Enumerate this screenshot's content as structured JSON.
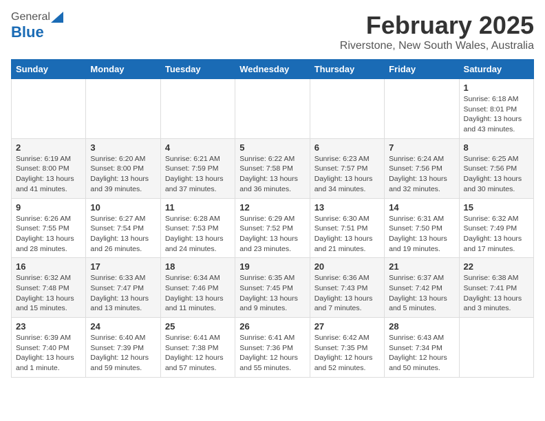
{
  "header": {
    "logo_general": "General",
    "logo_blue": "Blue",
    "month_title": "February 2025",
    "subtitle": "Riverstone, New South Wales, Australia"
  },
  "days_of_week": [
    "Sunday",
    "Monday",
    "Tuesday",
    "Wednesday",
    "Thursday",
    "Friday",
    "Saturday"
  ],
  "weeks": [
    [
      {
        "day": "",
        "info": ""
      },
      {
        "day": "",
        "info": ""
      },
      {
        "day": "",
        "info": ""
      },
      {
        "day": "",
        "info": ""
      },
      {
        "day": "",
        "info": ""
      },
      {
        "day": "",
        "info": ""
      },
      {
        "day": "1",
        "info": "Sunrise: 6:18 AM\nSunset: 8:01 PM\nDaylight: 13 hours\nand 43 minutes."
      }
    ],
    [
      {
        "day": "2",
        "info": "Sunrise: 6:19 AM\nSunset: 8:00 PM\nDaylight: 13 hours\nand 41 minutes."
      },
      {
        "day": "3",
        "info": "Sunrise: 6:20 AM\nSunset: 8:00 PM\nDaylight: 13 hours\nand 39 minutes."
      },
      {
        "day": "4",
        "info": "Sunrise: 6:21 AM\nSunset: 7:59 PM\nDaylight: 13 hours\nand 37 minutes."
      },
      {
        "day": "5",
        "info": "Sunrise: 6:22 AM\nSunset: 7:58 PM\nDaylight: 13 hours\nand 36 minutes."
      },
      {
        "day": "6",
        "info": "Sunrise: 6:23 AM\nSunset: 7:57 PM\nDaylight: 13 hours\nand 34 minutes."
      },
      {
        "day": "7",
        "info": "Sunrise: 6:24 AM\nSunset: 7:56 PM\nDaylight: 13 hours\nand 32 minutes."
      },
      {
        "day": "8",
        "info": "Sunrise: 6:25 AM\nSunset: 7:56 PM\nDaylight: 13 hours\nand 30 minutes."
      }
    ],
    [
      {
        "day": "9",
        "info": "Sunrise: 6:26 AM\nSunset: 7:55 PM\nDaylight: 13 hours\nand 28 minutes."
      },
      {
        "day": "10",
        "info": "Sunrise: 6:27 AM\nSunset: 7:54 PM\nDaylight: 13 hours\nand 26 minutes."
      },
      {
        "day": "11",
        "info": "Sunrise: 6:28 AM\nSunset: 7:53 PM\nDaylight: 13 hours\nand 24 minutes."
      },
      {
        "day": "12",
        "info": "Sunrise: 6:29 AM\nSunset: 7:52 PM\nDaylight: 13 hours\nand 23 minutes."
      },
      {
        "day": "13",
        "info": "Sunrise: 6:30 AM\nSunset: 7:51 PM\nDaylight: 13 hours\nand 21 minutes."
      },
      {
        "day": "14",
        "info": "Sunrise: 6:31 AM\nSunset: 7:50 PM\nDaylight: 13 hours\nand 19 minutes."
      },
      {
        "day": "15",
        "info": "Sunrise: 6:32 AM\nSunset: 7:49 PM\nDaylight: 13 hours\nand 17 minutes."
      }
    ],
    [
      {
        "day": "16",
        "info": "Sunrise: 6:32 AM\nSunset: 7:48 PM\nDaylight: 13 hours\nand 15 minutes."
      },
      {
        "day": "17",
        "info": "Sunrise: 6:33 AM\nSunset: 7:47 PM\nDaylight: 13 hours\nand 13 minutes."
      },
      {
        "day": "18",
        "info": "Sunrise: 6:34 AM\nSunset: 7:46 PM\nDaylight: 13 hours\nand 11 minutes."
      },
      {
        "day": "19",
        "info": "Sunrise: 6:35 AM\nSunset: 7:45 PM\nDaylight: 13 hours\nand 9 minutes."
      },
      {
        "day": "20",
        "info": "Sunrise: 6:36 AM\nSunset: 7:43 PM\nDaylight: 13 hours\nand 7 minutes."
      },
      {
        "day": "21",
        "info": "Sunrise: 6:37 AM\nSunset: 7:42 PM\nDaylight: 13 hours\nand 5 minutes."
      },
      {
        "day": "22",
        "info": "Sunrise: 6:38 AM\nSunset: 7:41 PM\nDaylight: 13 hours\nand 3 minutes."
      }
    ],
    [
      {
        "day": "23",
        "info": "Sunrise: 6:39 AM\nSunset: 7:40 PM\nDaylight: 13 hours\nand 1 minute."
      },
      {
        "day": "24",
        "info": "Sunrise: 6:40 AM\nSunset: 7:39 PM\nDaylight: 12 hours\nand 59 minutes."
      },
      {
        "day": "25",
        "info": "Sunrise: 6:41 AM\nSunset: 7:38 PM\nDaylight: 12 hours\nand 57 minutes."
      },
      {
        "day": "26",
        "info": "Sunrise: 6:41 AM\nSunset: 7:36 PM\nDaylight: 12 hours\nand 55 minutes."
      },
      {
        "day": "27",
        "info": "Sunrise: 6:42 AM\nSunset: 7:35 PM\nDaylight: 12 hours\nand 52 minutes."
      },
      {
        "day": "28",
        "info": "Sunrise: 6:43 AM\nSunset: 7:34 PM\nDaylight: 12 hours\nand 50 minutes."
      },
      {
        "day": "",
        "info": ""
      }
    ]
  ]
}
